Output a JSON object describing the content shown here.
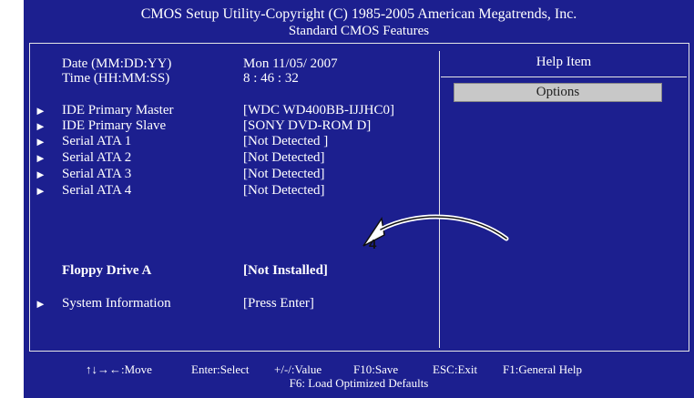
{
  "header": {
    "title": "CMOS Setup Utility-Copyright (C) 1985-2005 American Megatrends, Inc.",
    "subtitle": "Standard CMOS Features"
  },
  "main": {
    "date": {
      "label": "Date (MM:DD:YY)",
      "value": "Mon 11/05/ 2007"
    },
    "time": {
      "label": "Time (HH:MM:SS)",
      "value": "8 :  46 : 32"
    },
    "items": [
      {
        "label": "IDE Primary Master",
        "value": "[WDC WD400BB-IJJHC0]"
      },
      {
        "label": "IDE Primary Slave",
        "value": "[SONY  DVD-ROM D]"
      },
      {
        "label": "Serial ATA 1",
        "value": "[Not Detected ]"
      },
      {
        "label": "Serial ATA 2",
        "value": "[Not Detected]"
      },
      {
        "label": "Serial ATA 3",
        "value": "[Not Detected]"
      },
      {
        "label": "Serial ATA 4",
        "value": "[Not Detected]"
      }
    ],
    "floppy": {
      "label": "Floppy Drive A",
      "value": "[Not Installed]"
    },
    "sysinfo": {
      "label": "System Information",
      "value": "[Press Enter]"
    },
    "arrow_glyph": "►"
  },
  "help": {
    "title": "Help Item",
    "options_label": "Options"
  },
  "callout": {
    "number": "4"
  },
  "footer": {
    "move": "↑↓→←:Move",
    "select": "Enter:Select",
    "value": "+/-/:Value",
    "save": "F10:Save",
    "exit": "ESC:Exit",
    "help": "F1:General Help",
    "defaults": "F6: Load Optimized Defaults"
  },
  "colors": {
    "background": "#1c1f8f",
    "text": "#ffffff",
    "options_button": "#c8c8c8"
  }
}
